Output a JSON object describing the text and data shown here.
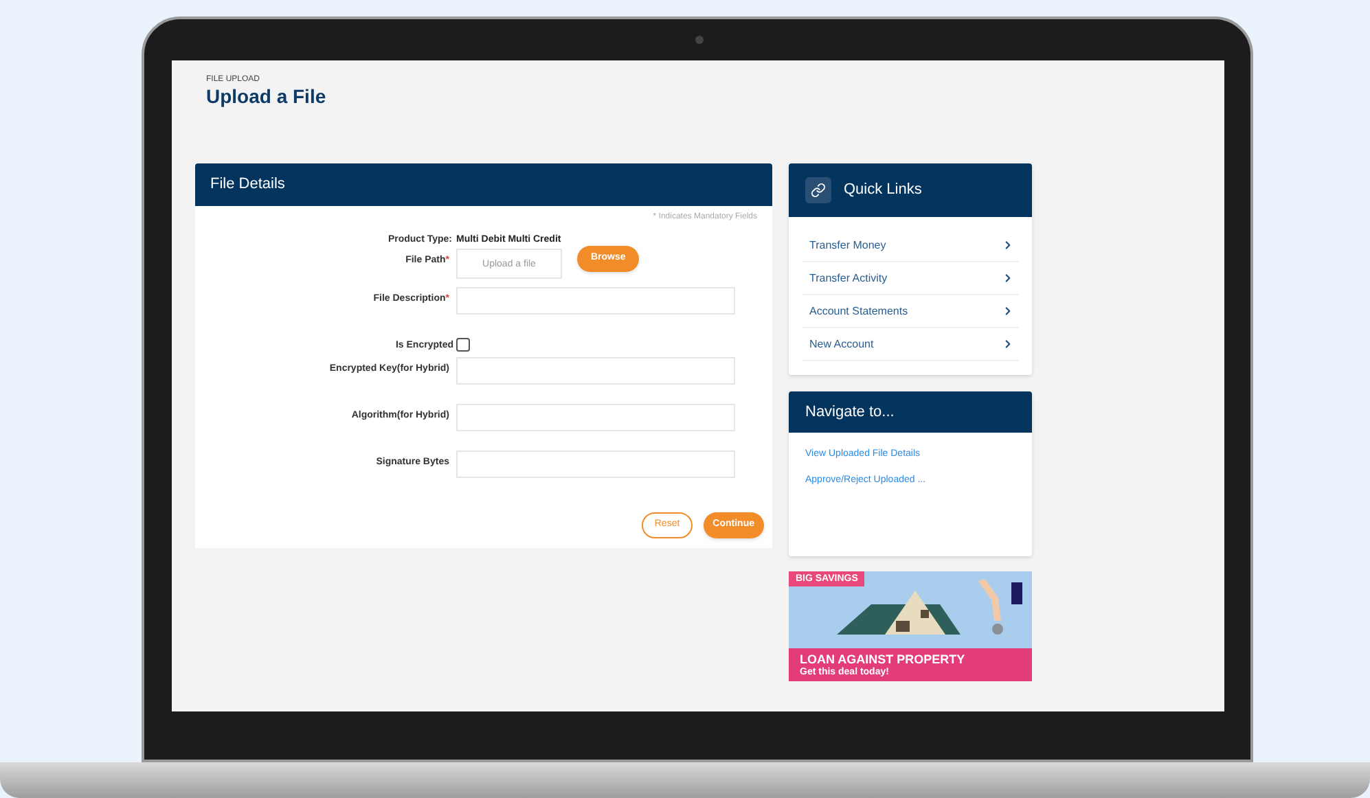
{
  "page": {
    "breadcrumb": "FILE UPLOAD",
    "title": "Upload a File"
  },
  "file_details": {
    "title": "File Details",
    "mandatory_note": "* Indicates Mandatory Fields",
    "required_mark": "*",
    "product_type": {
      "label": "Product Type:",
      "value": "Multi Debit Multi Credit"
    },
    "fields": [
      {
        "kind": "file",
        "label": "File Path",
        "required": true,
        "placeholder": "Upload a file",
        "button": "Browse"
      },
      {
        "kind": "text",
        "label": "File Description",
        "required": true
      },
      {
        "kind": "checkbox",
        "label": "Is Encrypted",
        "checked": false
      },
      {
        "kind": "text",
        "label": "Encrypted Key(for Hybrid)",
        "required": false
      },
      {
        "kind": "text",
        "label": "Algorithm(for Hybrid)",
        "required": false
      },
      {
        "kind": "text",
        "label": "Signature Bytes",
        "required": false
      }
    ],
    "buttons": [
      {
        "kind": "outline",
        "label": "Reset"
      },
      {
        "kind": "filled",
        "label": "Continue"
      }
    ]
  },
  "quick_links": {
    "title": "Quick Links",
    "items": [
      "Transfer Money",
      "Transfer Activity",
      "Account Statements",
      "New Account"
    ]
  },
  "navigate": {
    "title": "Navigate to...",
    "links": [
      "View Uploaded File Details",
      "Approve/Reject Uploaded ..."
    ]
  },
  "banner": {
    "tag": "BIG SAVINGS",
    "headline": "LOAN AGAINST PROPERTY",
    "cta": "Get this deal today!"
  }
}
